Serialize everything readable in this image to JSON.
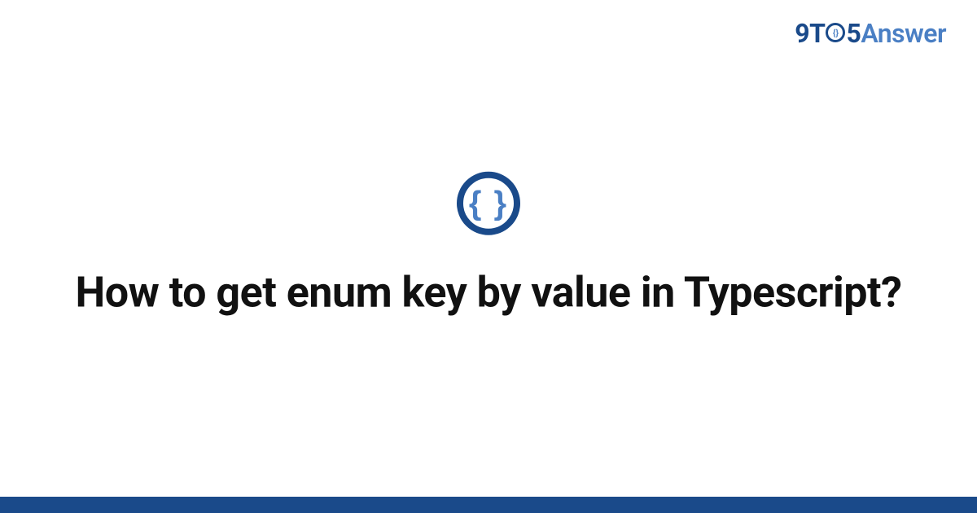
{
  "brand": {
    "nine": "9",
    "t": "T",
    "five": "5",
    "answer": "Answer",
    "braces": "{}"
  },
  "icon": {
    "braces": "{ }"
  },
  "title": "How to get enum key by value in Typescript?"
}
